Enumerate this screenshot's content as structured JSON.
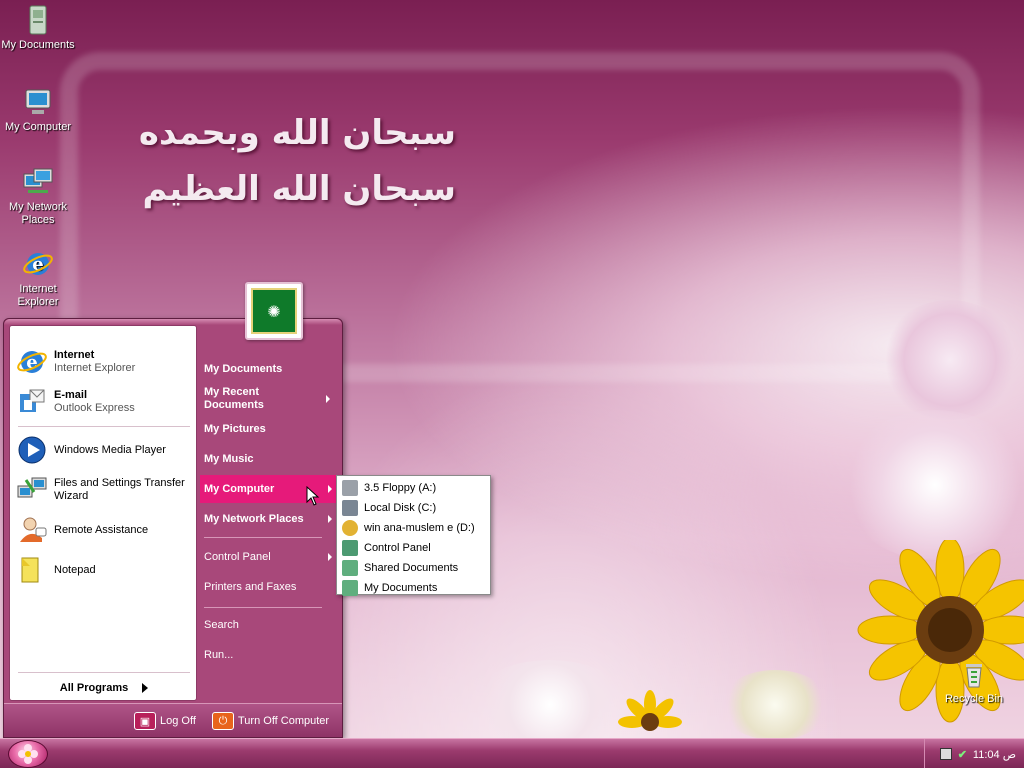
{
  "desktop": {
    "wallpaper_text_line1": "سبحان الله وبحمده",
    "wallpaper_text_line2": "سبحان الله العظيم",
    "icons": [
      {
        "label": "My Documents"
      },
      {
        "label": "My Computer"
      },
      {
        "label": "My Network Places"
      },
      {
        "label": "Internet Explorer"
      },
      {
        "label": "Recycle Bin"
      }
    ]
  },
  "start_menu": {
    "pinned": [
      {
        "title": "Internet",
        "subtitle": "Internet Explorer",
        "icon": "internet-explorer-icon"
      },
      {
        "title": "E-mail",
        "subtitle": "Outlook Express",
        "icon": "outlook-express-icon"
      }
    ],
    "recent": [
      {
        "label": "Windows Media Player",
        "icon": "media-player-icon"
      },
      {
        "label": "Files and Settings Transfer Wizard",
        "icon": "transfer-wizard-icon"
      },
      {
        "label": "Remote Assistance",
        "icon": "remote-assistance-icon"
      },
      {
        "label": "Notepad",
        "icon": "notepad-icon"
      }
    ],
    "all_programs": "All Programs",
    "right_items": [
      {
        "label": "My Documents"
      },
      {
        "label": "My Recent Documents"
      },
      {
        "label": "My Pictures"
      },
      {
        "label": "My Music"
      },
      {
        "label": "My Computer"
      },
      {
        "label": "My Network Places"
      },
      {
        "label": "Control Panel"
      },
      {
        "label": "Printers and Faxes"
      },
      {
        "label": "Search"
      },
      {
        "label": "Run..."
      }
    ],
    "log_off": "Log Off",
    "turn_off": "Turn Off Computer"
  },
  "my_computer_submenu": [
    {
      "label": "3.5 Floppy (A:)",
      "color": "#9aa0a8"
    },
    {
      "label": "Local Disk (C:)",
      "color": "#7a8694"
    },
    {
      "label": "win ana-muslem e (D:)",
      "color": "#e2b233"
    },
    {
      "label": "Control Panel",
      "color": "#4c9a72"
    },
    {
      "label": "Shared Documents",
      "color": "#5fae7e"
    },
    {
      "label": "My Documents",
      "color": "#5fae7e"
    }
  ],
  "taskbar": {
    "clock": "11:04 ص"
  }
}
